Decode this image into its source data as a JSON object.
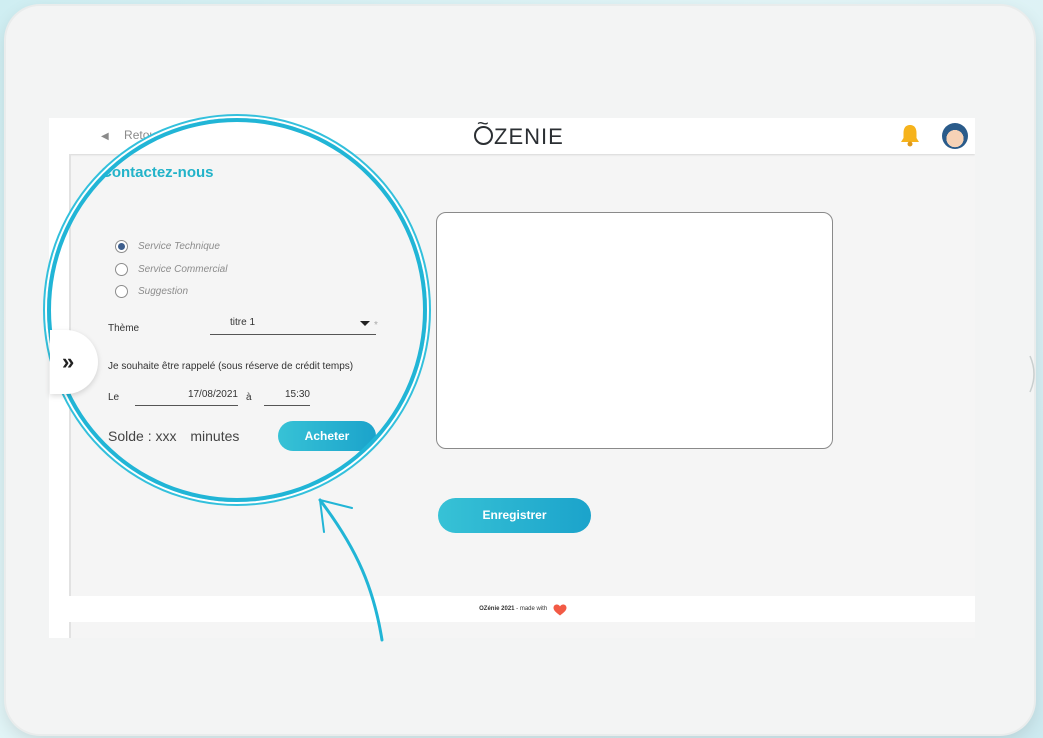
{
  "colors": {
    "accent": "#22b3c9",
    "lens_ring": "#21b5d6",
    "heart": "#f25a45"
  },
  "topbar": {
    "back_label": "Retour",
    "logo": "ZENIE",
    "logo_mark": "~"
  },
  "page": {
    "title": "Contactez-nous"
  },
  "services": {
    "options": [
      "Service Technique",
      "Service Commercial",
      "Suggestion"
    ],
    "selected_index": 0
  },
  "theme": {
    "label": "Thème",
    "value": "titre 1",
    "required_mark": "*"
  },
  "callback": {
    "label": "Je souhaite être rappelé (sous réserve de crédit temps)"
  },
  "date": {
    "le_label": "Le",
    "date_value": "17/08/2021",
    "a_label": "à",
    "time_value": "15:30"
  },
  "balance": {
    "label": "Solde :",
    "value": "xxx",
    "unit": "minutes"
  },
  "buttons": {
    "acheter": "Acheter",
    "enregistrer": "Enregistrer"
  },
  "footer": {
    "brand": "OZénie 2021",
    "text": "- made with"
  },
  "sidebar_toggle": {
    "glyph": "»"
  },
  "icons": {
    "bell": "bell-icon",
    "avatar": "avatar",
    "heart": "heart-icon"
  }
}
